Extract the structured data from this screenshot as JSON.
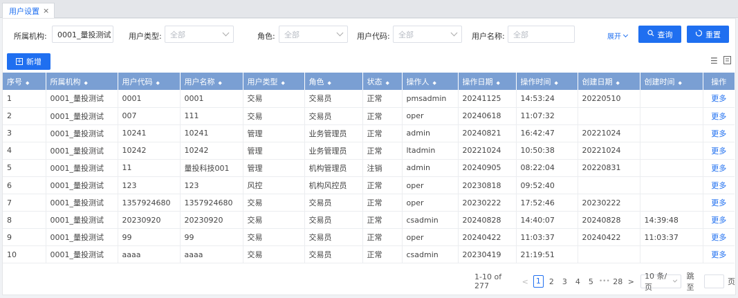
{
  "tab": {
    "label": "用户设置",
    "close": "×"
  },
  "filters": {
    "org": {
      "label": "所属机构:",
      "value": "0001_量投测试"
    },
    "user_type": {
      "label": "用户类型:",
      "placeholder": "全部"
    },
    "role": {
      "label": "角色:",
      "placeholder": "全部"
    },
    "user_code": {
      "label": "用户代码:",
      "placeholder": "全部"
    },
    "user_name": {
      "label": "用户名称:",
      "placeholder": "全部"
    },
    "expand_label": "展开",
    "query_label": "查询",
    "reset_label": "重置"
  },
  "toolbar": {
    "add_label": "新增"
  },
  "icons": {
    "query": "search-icon",
    "reset": "reset-icon",
    "add": "plus-icon",
    "columns": "list-icon",
    "export": "export-icon"
  },
  "colors": {
    "primary": "#1f6ff0",
    "header": "#7a9fd3"
  },
  "table": {
    "headers": [
      "序号",
      "所属机构",
      "用户代码",
      "用户名称",
      "用户类型",
      "角色",
      "状态",
      "操作人",
      "操作日期",
      "操作时间",
      "创建日期",
      "创建时间",
      "操作"
    ],
    "sort_glyph": "◆",
    "rows": [
      [
        "1",
        "0001_量投测试",
        "0001",
        "0001",
        "交易",
        "交易员",
        "正常",
        "pmsadmin",
        "20241125",
        "14:53:24",
        "20220510",
        "",
        "更多"
      ],
      [
        "2",
        "0001_量投测试",
        "007",
        "111",
        "交易",
        "交易员",
        "正常",
        "oper",
        "20240618",
        "11:07:32",
        "",
        "",
        "更多"
      ],
      [
        "3",
        "0001_量投测试",
        "10241",
        "10241",
        "管理",
        "业务管理员",
        "正常",
        "admin",
        "20240821",
        "16:42:47",
        "20221024",
        "",
        "更多"
      ],
      [
        "4",
        "0001_量投测试",
        "10242",
        "10242",
        "管理",
        "业务管理员",
        "正常",
        "ltadmin",
        "20221024",
        "10:50:38",
        "20221024",
        "",
        "更多"
      ],
      [
        "5",
        "0001_量投测试",
        "11",
        "量投科技001",
        "管理",
        "机构管理员",
        "注销",
        "admin",
        "20240905",
        "08:22:04",
        "20220831",
        "",
        "更多"
      ],
      [
        "6",
        "0001_量投测试",
        "123",
        "123",
        "风控",
        "机构风控员",
        "正常",
        "oper",
        "20230818",
        "09:52:40",
        "",
        "",
        "更多"
      ],
      [
        "7",
        "0001_量投测试",
        "1357924680",
        "1357924680",
        "交易",
        "交易员",
        "正常",
        "oper",
        "20230222",
        "17:52:46",
        "20230222",
        "",
        "更多"
      ],
      [
        "8",
        "0001_量投测试",
        "20230920",
        "20230920",
        "交易",
        "交易员",
        "正常",
        "csadmin",
        "20240828",
        "14:40:07",
        "20240828",
        "14:39:48",
        "更多"
      ],
      [
        "9",
        "0001_量投测试",
        "99",
        "99",
        "交易",
        "交易员",
        "正常",
        "oper",
        "20240422",
        "11:03:37",
        "20240422",
        "11:03:37",
        "更多"
      ],
      [
        "10",
        "0001_量投测试",
        "aaaa",
        "aaaa",
        "交易",
        "交易员",
        "正常",
        "csadmin",
        "20230419",
        "21:19:51",
        "",
        "",
        "更多"
      ]
    ]
  },
  "pagination": {
    "total": "1-10 of 277",
    "prev": "<",
    "next": ">",
    "pages": [
      "1",
      "2",
      "3",
      "4",
      "5",
      "•••",
      "28"
    ],
    "current": "1",
    "page_size": "10 条/页",
    "jump_label": "跳至",
    "page_suffix": "页"
  }
}
